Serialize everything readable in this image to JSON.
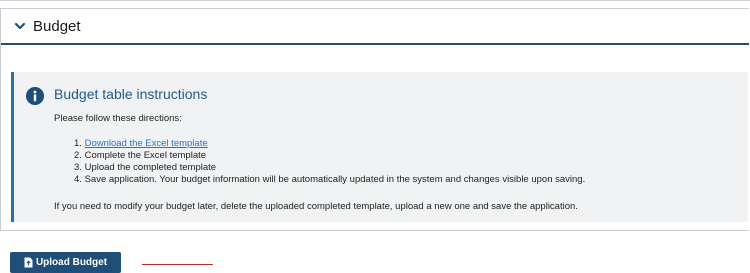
{
  "panel": {
    "title": "Budget",
    "chevron_icon": "chevron-down-icon"
  },
  "instructions": {
    "icon": "info-circle-icon",
    "title": "Budget table instructions",
    "intro": "Please follow these directions:",
    "steps": [
      {
        "number": "1.",
        "text": "Download the Excel template",
        "is_link": true
      },
      {
        "number": "2.",
        "text": "Complete the Excel template",
        "is_link": false
      },
      {
        "number": "3.",
        "text": "Upload the completed template",
        "is_link": false
      },
      {
        "number": "4.",
        "text": "Save application. Your budget information will be automatically updated in the system and changes visible upon saving.",
        "is_link": false
      }
    ],
    "footer": "If you need to modify your budget later, delete the uploaded completed template, upload a new one and save the application."
  },
  "upload_button": {
    "label": "Upload Budget",
    "icon": "file-upload-icon"
  },
  "colors": {
    "header_rule": "#1f4e7a",
    "accent_bar": "#2c6ea6",
    "instructions_bg": "#f0f2f3",
    "title_blue": "#1f5a8a",
    "link": "#2a73c4",
    "button_bg": "#1f4e79",
    "red_mark": "#c0282c"
  }
}
